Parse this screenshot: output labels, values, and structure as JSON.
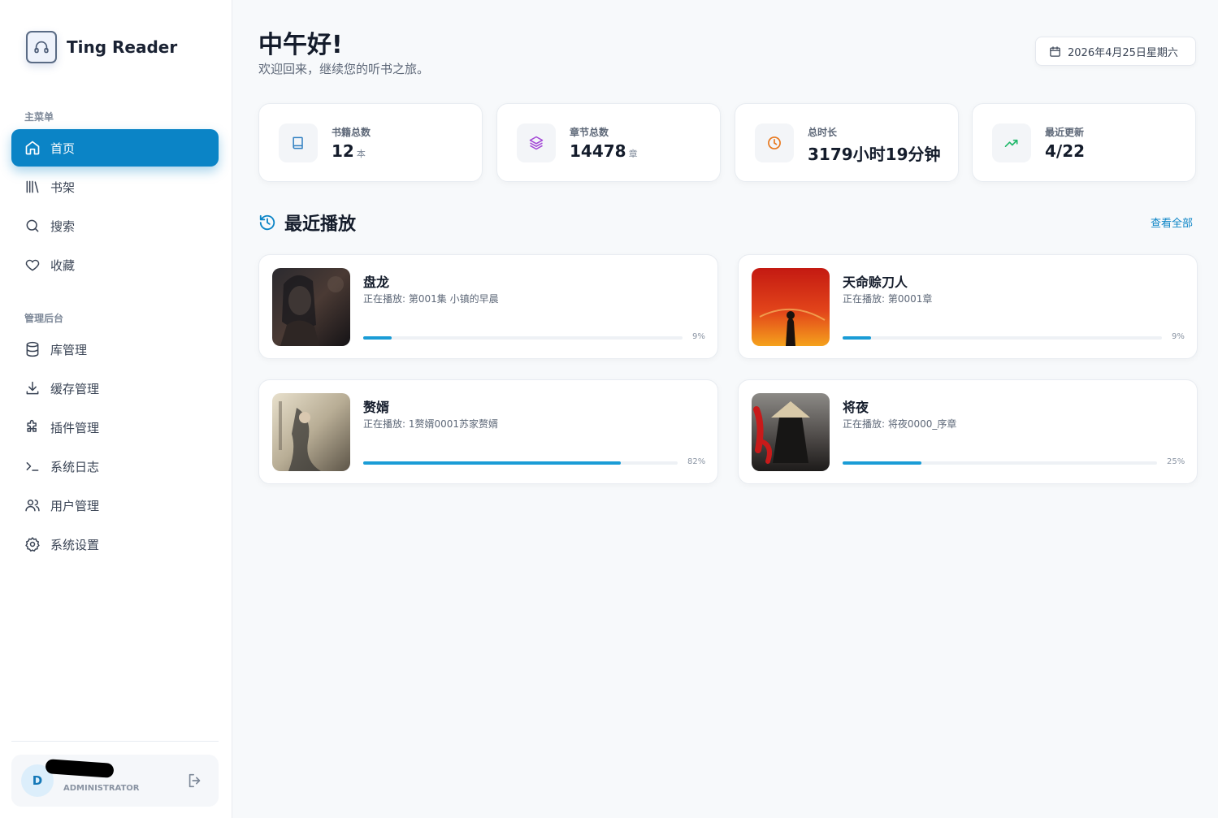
{
  "app": {
    "name": "Ting Reader"
  },
  "sidebar": {
    "main_label": "主菜单",
    "main_items": [
      {
        "label": "首页",
        "icon": "home-icon",
        "active": true
      },
      {
        "label": "书架",
        "icon": "library-icon"
      },
      {
        "label": "搜索",
        "icon": "search-icon"
      },
      {
        "label": "收藏",
        "icon": "heart-icon"
      }
    ],
    "admin_label": "管理后台",
    "admin_items": [
      {
        "label": "库管理",
        "icon": "database-icon"
      },
      {
        "label": "缓存管理",
        "icon": "download-icon"
      },
      {
        "label": "插件管理",
        "icon": "puzzle-icon"
      },
      {
        "label": "系统日志",
        "icon": "terminal-icon"
      },
      {
        "label": "用户管理",
        "icon": "users-icon"
      },
      {
        "label": "系统设置",
        "icon": "gear-icon"
      }
    ],
    "user": {
      "initial": "D",
      "role": "ADMINISTRATOR"
    }
  },
  "header": {
    "greeting": "中午好!",
    "subtitle": "欢迎回来，继续您的听书之旅。",
    "date": "2026年4月25日星期六"
  },
  "stats": [
    {
      "label": "书籍总数",
      "value": "12",
      "unit": "本",
      "icon": "book-icon",
      "color": "#2f7fc1"
    },
    {
      "label": "章节总数",
      "value": "14478",
      "unit": "章",
      "icon": "layers-icon",
      "color": "#a347d6"
    },
    {
      "label": "总时长",
      "value": "3179小时19分钟",
      "unit": "",
      "icon": "clock-icon",
      "color": "#e8771c"
    },
    {
      "label": "最近更新",
      "value": "4/22",
      "unit": "",
      "icon": "trending-up-icon",
      "color": "#1fb86a"
    }
  ],
  "recent": {
    "title": "最近播放",
    "view_all": "查看全部",
    "books": [
      {
        "title": "盘龙",
        "now_playing": "正在播放: 第001集 小镇的早晨",
        "progress": 9,
        "progress_label": "9%"
      },
      {
        "title": "天命赊刀人",
        "now_playing": "正在播放: 第0001章",
        "progress": 9,
        "progress_label": "9%"
      },
      {
        "title": "赘婿",
        "now_playing": "正在播放: 1赘婿0001苏家赘婿",
        "progress": 82,
        "progress_label": "82%"
      },
      {
        "title": "将夜",
        "now_playing": "正在播放: 将夜0000_序章",
        "progress": 25,
        "progress_label": "25%"
      }
    ]
  },
  "colors": {
    "accent": "#0b84c6",
    "progress": "#1a9cd6"
  }
}
